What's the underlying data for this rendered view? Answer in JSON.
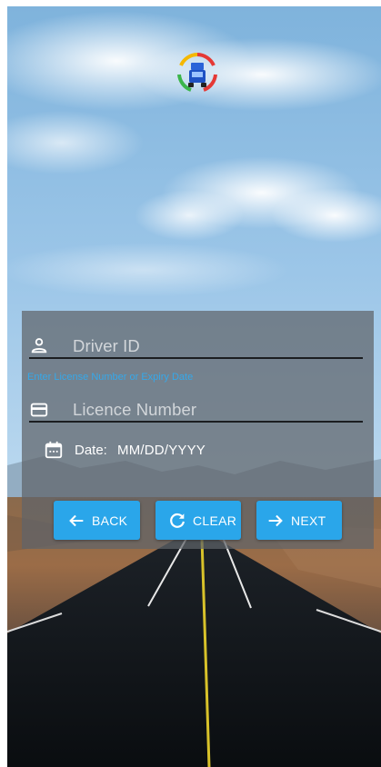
{
  "logo": {
    "icon": "truck-logo-icon",
    "ring_colors": [
      "#e53935",
      "#f5b800",
      "#3bb54a"
    ]
  },
  "form": {
    "driver_id": {
      "placeholder": "Driver ID",
      "icon": "person-icon"
    },
    "helper_text": "Enter License Number or Expiry Date",
    "licence_number": {
      "placeholder": "Licence Number",
      "icon": "card-icon"
    },
    "date": {
      "label": "Date:",
      "value": "MM/DD/YYYY",
      "icon": "calendar-icon"
    }
  },
  "buttons": {
    "back": {
      "label": "BACK",
      "icon": "arrow-left-icon"
    },
    "clear": {
      "label": "CLEAR",
      "icon": "refresh-icon"
    },
    "next": {
      "label": "NEXT",
      "icon": "arrow-right-icon"
    }
  },
  "colors": {
    "accent": "#2aa6ea",
    "helper": "#35a8ea",
    "panel": "rgba(95,100,105,0.72)"
  }
}
